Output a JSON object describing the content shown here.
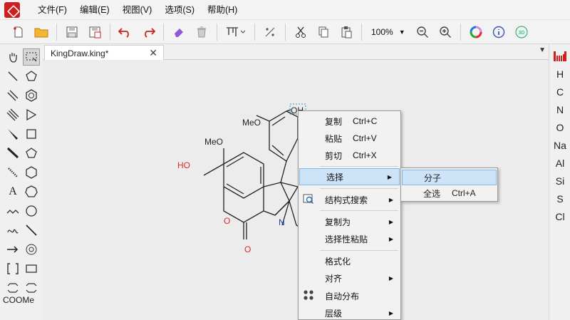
{
  "menubar": {
    "items": [
      "文件(F)",
      "编辑(E)",
      "视图(V)",
      "选项(S)",
      "帮助(H)"
    ]
  },
  "toolbar": {
    "zoom": "100%"
  },
  "leftbar": {
    "coome_label": "COOMe"
  },
  "document": {
    "tab_title": "KingDraw.king*",
    "close_glyph": "✕",
    "tab_menu_glyph": "▼"
  },
  "molecule": {
    "labels": {
      "oh_top": "OH",
      "meo_1": "MeO",
      "meo_2": "MeO",
      "ho": "HO",
      "o_ring": "O",
      "o_carbonyl": "O",
      "n": "N"
    }
  },
  "rightbar": {
    "elements": [
      "H",
      "C",
      "N",
      "O",
      "Na",
      "Al",
      "Si",
      "S",
      "Cl"
    ]
  },
  "context_menu": {
    "copy": {
      "label": "复制",
      "shortcut": "Ctrl+C"
    },
    "paste": {
      "label": "粘贴",
      "shortcut": "Ctrl+V"
    },
    "cut": {
      "label": "剪切",
      "shortcut": "Ctrl+X"
    },
    "select": {
      "label": "选择"
    },
    "structure_search": {
      "label": "结构式搜索"
    },
    "copy_as": {
      "label": "复制为"
    },
    "paste_special": {
      "label": "选择性粘贴"
    },
    "format": {
      "label": "格式化"
    },
    "align": {
      "label": "对齐"
    },
    "auto_distribute": {
      "label": "自动分布"
    },
    "layer": {
      "label": "层级"
    },
    "arrow_glyph": "▶"
  },
  "submenu": {
    "molecule": {
      "label": "分子"
    },
    "select_all": {
      "label": "全选",
      "shortcut": "Ctrl+A"
    }
  },
  "colors": {
    "accent_red": "#d01e1e",
    "highlight": "#cde3f7",
    "highlight_border": "#88b5e3",
    "heteroatom_red": "#e0282a",
    "nitrogen_blue": "#1f3fa6"
  }
}
